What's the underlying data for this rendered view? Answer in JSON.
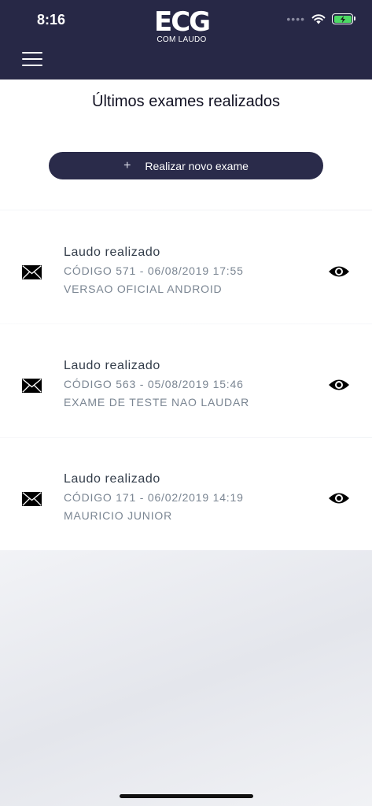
{
  "status_bar": {
    "time": "8:16"
  },
  "logo": {
    "main": "ECG",
    "sub": "COM LAUDO"
  },
  "page": {
    "title": "Últimos exames realizados"
  },
  "actions": {
    "new_exam_plus": "+",
    "new_exam_label": "Realizar novo exame"
  },
  "exams": [
    {
      "title": "Laudo realizado",
      "code": "CÓDIGO 571 - 06/08/2019 17:55",
      "description": "VERSAO OFICIAL ANDROID"
    },
    {
      "title": "Laudo realizado",
      "code": "CÓDIGO 563 - 05/08/2019 15:46",
      "description": "EXAME DE TESTE NAO LAUDAR"
    },
    {
      "title": "Laudo realizado",
      "code": "CÓDIGO 171 - 06/02/2019 14:19",
      "description": "MAURICIO JUNIOR"
    }
  ],
  "colors": {
    "header": "#272846",
    "button": "#2a2b4a",
    "battery": "#4cd964"
  },
  "icons": [
    "menu-icon",
    "wifi-icon",
    "battery-icon",
    "mail-icon",
    "eye-icon",
    "plus-icon"
  ]
}
